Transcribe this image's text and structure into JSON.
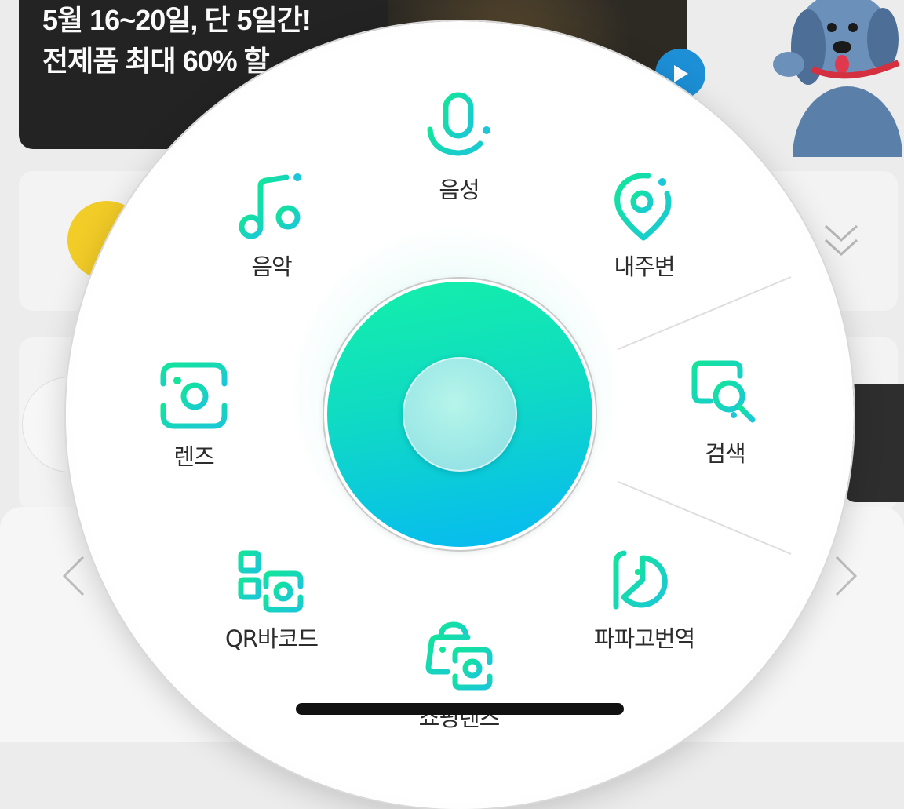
{
  "background": {
    "banner": {
      "line1": "5월 16~20일, 단 5일간!",
      "line2": "전제품 최대 60% 할"
    }
  },
  "menu": {
    "items": {
      "voice": {
        "label": "음성",
        "icon": "microphone-icon"
      },
      "music": {
        "label": "음악",
        "icon": "music-note-icon"
      },
      "nearby": {
        "label": "내주변",
        "icon": "location-pin-icon"
      },
      "lens": {
        "label": "렌즈",
        "icon": "camera-lens-icon"
      },
      "search": {
        "label": "검색",
        "icon": "search-box-icon"
      },
      "qr": {
        "label": "QR바코드",
        "icon": "qr-barcode-icon"
      },
      "papago": {
        "label": "파파고번역",
        "icon": "papago-translate-icon"
      },
      "shopping": {
        "label": "쇼핑렌즈",
        "icon": "shopping-lens-icon"
      }
    },
    "center": {
      "icon": "green-dot-button"
    }
  },
  "colors": {
    "accent_start": "#14f0a8",
    "accent_end": "#06b8f4"
  }
}
